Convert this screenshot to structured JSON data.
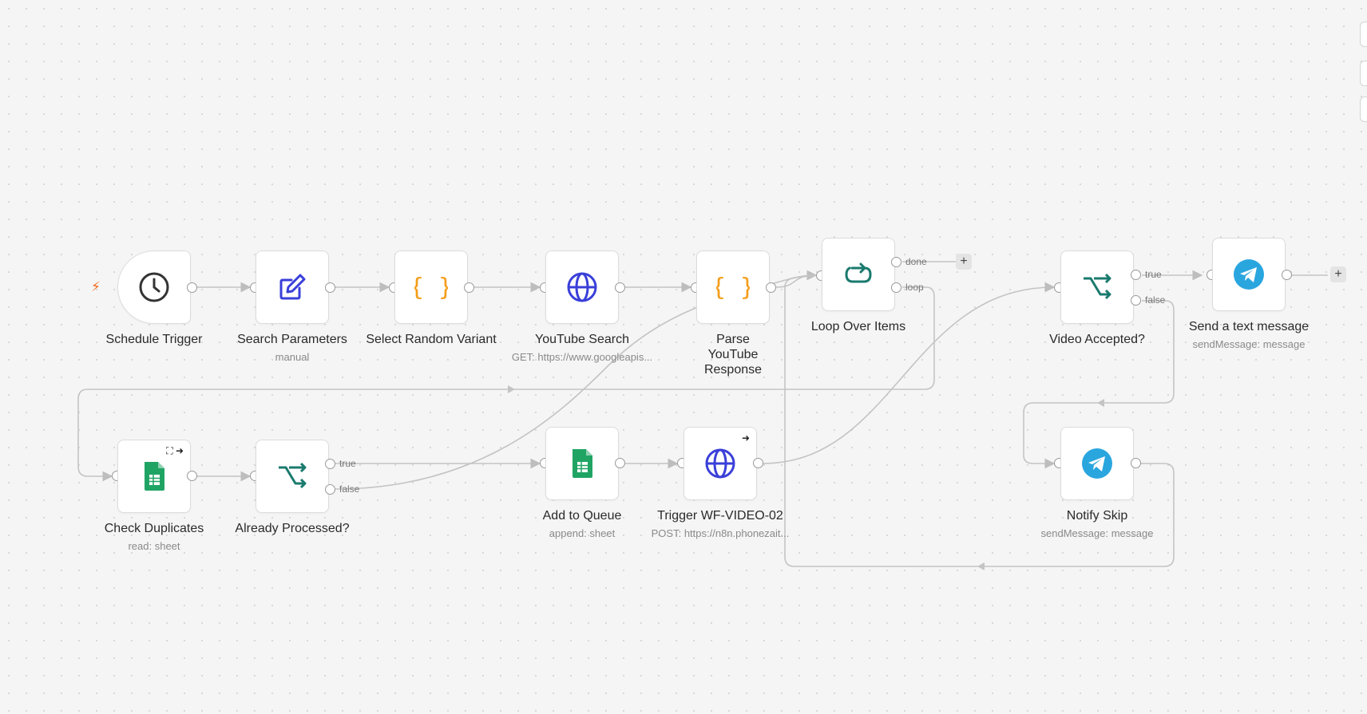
{
  "workflow": {
    "nodes": [
      {
        "id": "schedule",
        "label": "Schedule Trigger",
        "sub": "",
        "icon": "clock-icon"
      },
      {
        "id": "search_params",
        "label": "Search Parameters",
        "sub": "manual",
        "icon": "edit-icon"
      },
      {
        "id": "random_variant",
        "label": "Select Random Variant",
        "sub": "",
        "icon": "code-braces-icon"
      },
      {
        "id": "youtube_search",
        "label": "YouTube Search",
        "sub": "GET: https://www.googleapis...",
        "icon": "globe-icon"
      },
      {
        "id": "parse_response",
        "label": "Parse YouTube Response",
        "sub": "",
        "icon": "code-braces-icon"
      },
      {
        "id": "loop",
        "label": "Loop Over Items",
        "sub": "",
        "icon": "loop-icon"
      },
      {
        "id": "video_accepted",
        "label": "Video Accepted?",
        "sub": "",
        "icon": "branch-icon"
      },
      {
        "id": "send_message",
        "label": "Send a text message",
        "sub": "sendMessage: message",
        "icon": "telegram-icon"
      },
      {
        "id": "check_duplicates",
        "label": "Check Duplicates",
        "sub": "read: sheet",
        "icon": "sheets-icon"
      },
      {
        "id": "already_processed",
        "label": "Already Processed?",
        "sub": "",
        "icon": "branch-icon"
      },
      {
        "id": "add_queue",
        "label": "Add to Queue",
        "sub": "append: sheet",
        "icon": "sheets-icon"
      },
      {
        "id": "trigger_wf",
        "label": "Trigger WF-VIDEO-02",
        "sub": "POST: https://n8n.phonezait...",
        "icon": "globe-icon"
      },
      {
        "id": "notify_skip",
        "label": "Notify Skip",
        "sub": "sendMessage: message",
        "icon": "telegram-icon"
      }
    ],
    "branches": {
      "done": "done",
      "loop": "loop",
      "true": "true",
      "false": "false"
    },
    "plus_label": "+",
    "trigger_symbol": "⚡"
  },
  "colors": {
    "background": "#f5f5f5",
    "edge": "#bdbdbd",
    "blue": "#3a3fd9",
    "orange": "#f59e1b",
    "teal": "#1a7a6e",
    "sheets_green": "#20a464",
    "telegram": "#2aa6df",
    "trigger_bolt": "#f26b1d"
  }
}
